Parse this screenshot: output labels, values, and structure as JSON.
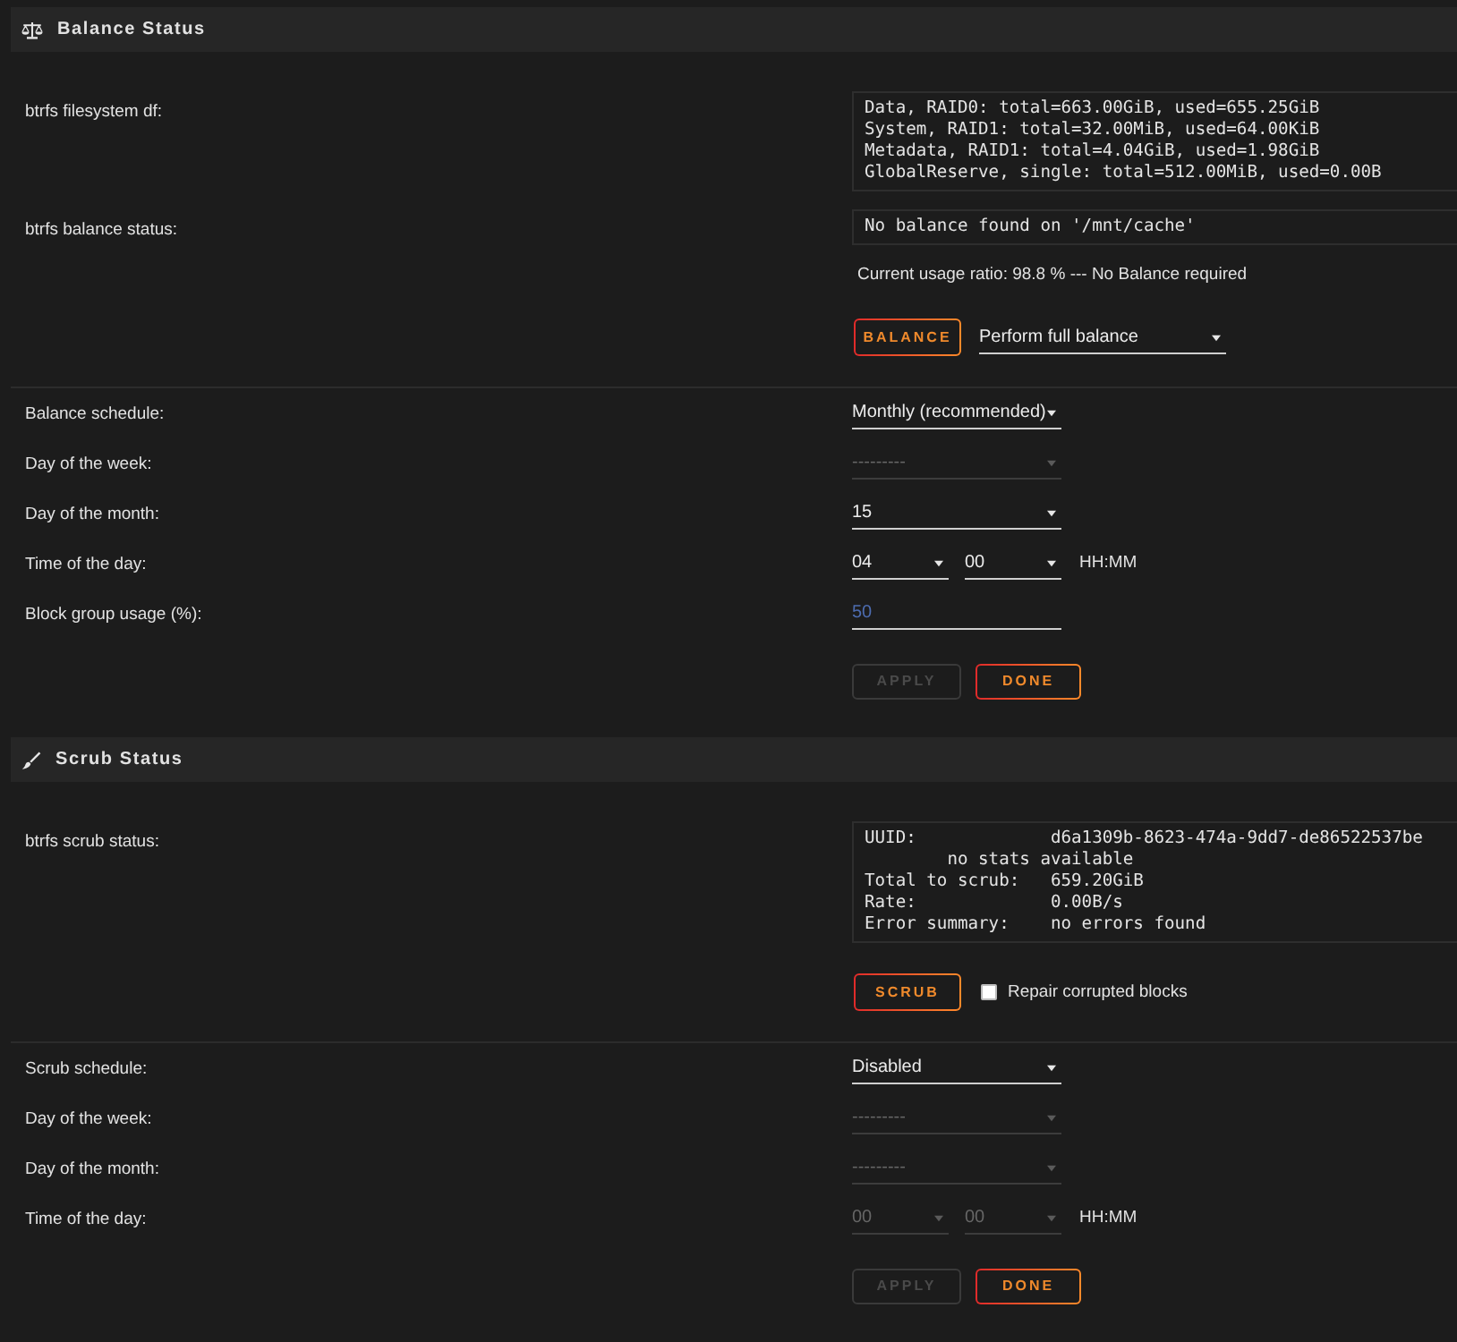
{
  "sections": [
    {
      "kind": "balance",
      "title": "Balance Status",
      "outputs": [
        {
          "label": "btrfs filesystem df:",
          "text": "Data, RAID0: total=663.00GiB, used=655.25GiB\nSystem, RAID1: total=32.00MiB, used=64.00KiB\nMetadata, RAID1: total=4.04GiB, used=1.98GiB\nGlobalReserve, single: total=512.00MiB, used=0.00B"
        },
        {
          "label": "btrfs balance status:",
          "text": "No balance found on '/mnt/cache'"
        }
      ],
      "note": "Current usage ratio: 98.8 % --- No Balance required",
      "actions": [
        {
          "kind": "button",
          "label": "BALANCE"
        },
        {
          "kind": "select",
          "value": "Perform full balance"
        }
      ],
      "schedule": [
        {
          "kind": "select",
          "label": "Balance schedule:",
          "value": "Monthly (recommended)",
          "disabled": false
        },
        {
          "kind": "select",
          "label": "Day of the week:",
          "value": "---------",
          "disabled": true
        },
        {
          "kind": "select",
          "label": "Day of the month:",
          "value": "15",
          "disabled": false
        },
        {
          "kind": "time",
          "label": "Time of the day:",
          "fields": [
            {
              "value": "04",
              "disabled": false
            },
            {
              "value": "00",
              "disabled": false
            }
          ],
          "format": "HH:MM"
        },
        {
          "kind": "input",
          "label": "Block group usage (%):",
          "value": "50",
          "disabled": false
        }
      ],
      "buttons": [
        {
          "label": "APPLY",
          "disabled": true
        },
        {
          "label": "DONE",
          "disabled": false
        }
      ]
    },
    {
      "kind": "scrub",
      "title": "Scrub Status",
      "outputs": [
        {
          "label": "btrfs scrub status:",
          "text": "UUID:             d6a1309b-8623-474a-9dd7-de86522537be\n        no stats available\nTotal to scrub:   659.20GiB\nRate:             0.00B/s\nError summary:    no errors found"
        }
      ],
      "actions": [
        {
          "kind": "button",
          "label": "SCRUB"
        },
        {
          "kind": "checkbox",
          "label": "Repair corrupted blocks",
          "checked": false
        }
      ],
      "schedule": [
        {
          "kind": "select",
          "label": "Scrub schedule:",
          "value": "Disabled",
          "disabled": false
        },
        {
          "kind": "select",
          "label": "Day of the week:",
          "value": "---------",
          "disabled": true
        },
        {
          "kind": "select",
          "label": "Day of the month:",
          "value": "---------",
          "disabled": true
        },
        {
          "kind": "time",
          "label": "Time of the day:",
          "fields": [
            {
              "value": "00",
              "disabled": true
            },
            {
              "value": "00",
              "disabled": true
            }
          ],
          "format": "HH:MM"
        }
      ],
      "buttons": [
        {
          "label": "APPLY",
          "disabled": true
        },
        {
          "label": "DONE",
          "disabled": false
        }
      ]
    }
  ]
}
